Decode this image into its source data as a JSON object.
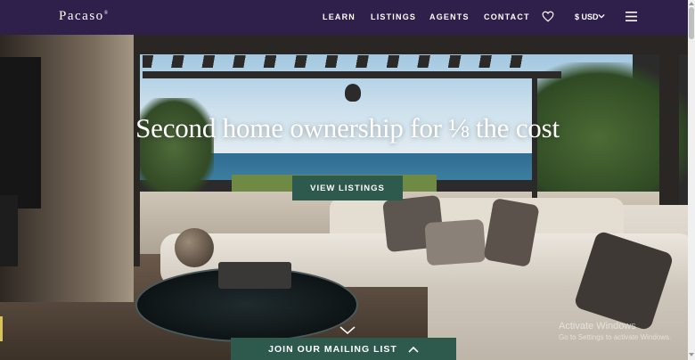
{
  "navbar": {
    "logo": "Pacaso",
    "logo_mark": "®",
    "links": [
      "LEARN",
      "LISTINGS",
      "AGENTS",
      "CONTACT"
    ],
    "favorites_icon": "heart-icon",
    "currency": "$ USD",
    "currency_icon": "chevron-down-icon",
    "menu_icon": "hamburger-menu-icon"
  },
  "hero": {
    "headline": "Second home ownership for ⅛ the cost",
    "cta_label": "VIEW LISTINGS",
    "scroll_icon": "chevron-down-icon",
    "background": "living-room-ocean-view-photo"
  },
  "mailing": {
    "label": "JOIN OUR MAILING LIST",
    "icon": "chevron-up-icon"
  },
  "os_watermark": {
    "line1": "Activate Windows",
    "line2": "Go to Settings to activate Windows."
  },
  "colors": {
    "nav_bg": "#2f1f4b",
    "button_bg": "#2d5a4c",
    "text": "#ffffff"
  }
}
